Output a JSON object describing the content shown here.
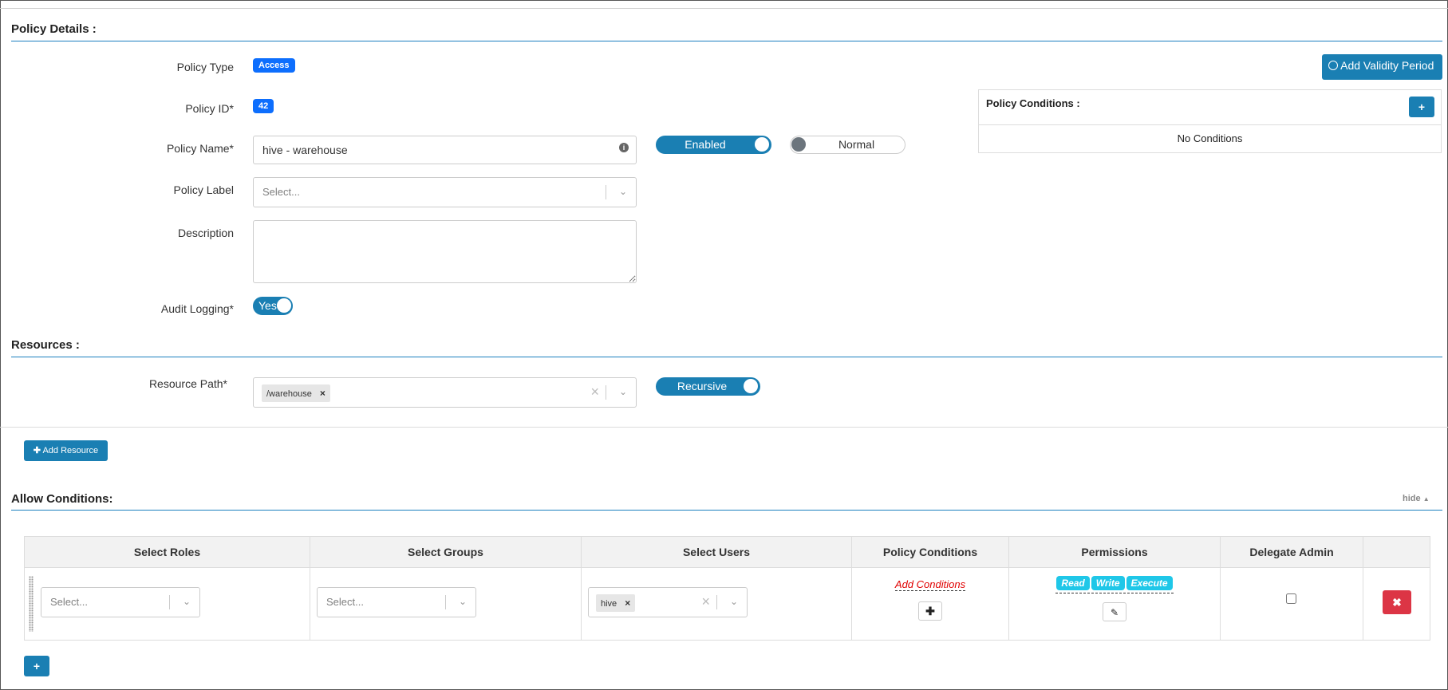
{
  "policy_details": {
    "title": "Policy Details :",
    "policy_type_label": "Policy Type",
    "policy_type_value": "Access",
    "policy_id_label": "Policy ID*",
    "policy_id_value": "42",
    "policy_name_label": "Policy Name*",
    "policy_name_value": "hive - warehouse",
    "enabled_toggle": "Enabled",
    "normal_toggle": "Normal",
    "policy_label_label": "Policy Label",
    "policy_label_placeholder": "Select...",
    "description_label": "Description",
    "description_value": "",
    "audit_logging_label": "Audit Logging*",
    "audit_logging_value": "Yes",
    "add_validity_period": "Add Validity Period",
    "conditions_title": "Policy Conditions :",
    "conditions_add": "+",
    "no_conditions": "No Conditions"
  },
  "resources": {
    "title": "Resources :",
    "resource_path_label": "Resource Path*",
    "resource_path_tag": "/warehouse",
    "recursive_toggle": "Recursive",
    "add_resource": "Add Resource"
  },
  "allow_conditions": {
    "title": "Allow Conditions:",
    "hide_link": "hide",
    "columns": [
      "Select Roles",
      "Select Groups",
      "Select Users",
      "Policy Conditions",
      "Permissions",
      "Delegate Admin",
      ""
    ],
    "row": {
      "roles_placeholder": "Select...",
      "groups_placeholder": "Select...",
      "user_tag": "hive",
      "add_conditions": "Add Conditions",
      "permissions": [
        "Read",
        "Write",
        "Execute"
      ],
      "delegate_admin": false
    },
    "add_row": "+"
  },
  "colors": {
    "accent": "#1a7fb3",
    "badge": "#0d6efd",
    "permission": "#1fc7e8",
    "danger": "#dc3545",
    "add_conditions": "#e00000"
  }
}
